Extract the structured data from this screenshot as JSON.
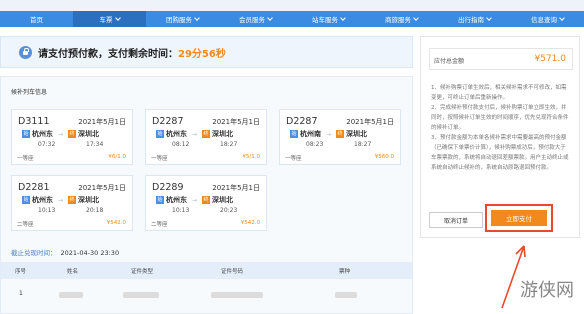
{
  "nav": {
    "items": [
      {
        "label": "首页",
        "dropdown": false
      },
      {
        "label": "车票",
        "dropdown": true,
        "active": true
      },
      {
        "label": "团购服务",
        "dropdown": true
      },
      {
        "label": "会员服务",
        "dropdown": true
      },
      {
        "label": "站车服务",
        "dropdown": true
      },
      {
        "label": "商旅服务",
        "dropdown": true
      },
      {
        "label": "出行指南",
        "dropdown": true
      },
      {
        "label": "信息查询",
        "dropdown": true
      }
    ]
  },
  "timer": {
    "text": "请支付预付款，支付剩余时间：",
    "value": "29分56秒"
  },
  "trains": {
    "title": "候补列车信息",
    "cards": [
      {
        "train_no": "D3111",
        "date": "2021年5月1日",
        "from": "杭州东",
        "to": "深圳北",
        "dep": "07:32",
        "arr": "17:34",
        "seat": "一等座",
        "price": "¥6/1.0"
      },
      {
        "train_no": "D2287",
        "date": "2021年5月1日",
        "from": "杭州东",
        "to": "深圳北",
        "dep": "08:12",
        "arr": "18:27",
        "seat": "一等座",
        "price": "¥5/1.0"
      },
      {
        "train_no": "D2287",
        "date": "2021年5月1日",
        "from": "杭州南",
        "to": "深圳北",
        "dep": "08:23",
        "arr": "18:27",
        "seat": "一等座",
        "price": "¥560.0"
      },
      {
        "train_no": "D2281",
        "date": "2021年5月1日",
        "from": "杭州东",
        "to": "深圳北",
        "dep": "10:13",
        "arr": "20:18",
        "seat": "二等座",
        "price": "¥542.0"
      },
      {
        "train_no": "D2289",
        "date": "2021年5月1日",
        "from": "杭州东",
        "to": "深圳北",
        "dep": "10:13",
        "arr": "20:23",
        "seat": "二等座",
        "price": "¥542.0"
      }
    ],
    "start_tag": "始",
    "end_tag": "终"
  },
  "deadline": {
    "label": "截止兑现时间：",
    "value": "2021-04-30 23:30"
  },
  "passengers": {
    "headers": [
      "序号",
      "姓名",
      "证件类型",
      "证件号码",
      "票种"
    ],
    "rows": [
      {
        "index": "1"
      }
    ]
  },
  "payment": {
    "amount_label": "应付总金额",
    "amount": "¥571.0",
    "tips": "1、候补购票订单生效后，相关候补需求不可修改，如需变更，可终止订单后重新操作。\n2、完成候补预付款支付后，候补购票订单立即生效，并同时，按照候补订单生效的时间顺序，优先兑现符合条件的候补订单。\n3、预付款金额为本单各候补需求中需要最高的预付金额（已确保下单票价计算），候补购票成功后，预付款大于车票票款的，系统将自动退回差额票款。用户主动终止或系统自动终止候补的，系统自动原路退回预付款。",
    "cancel_label": "取消订单",
    "pay_label": "立即支付"
  },
  "watermark": "游侠网",
  "colors": {
    "nav": "#3b8be2",
    "accent": "#f08a1d",
    "highlight": "#e94b2a"
  }
}
